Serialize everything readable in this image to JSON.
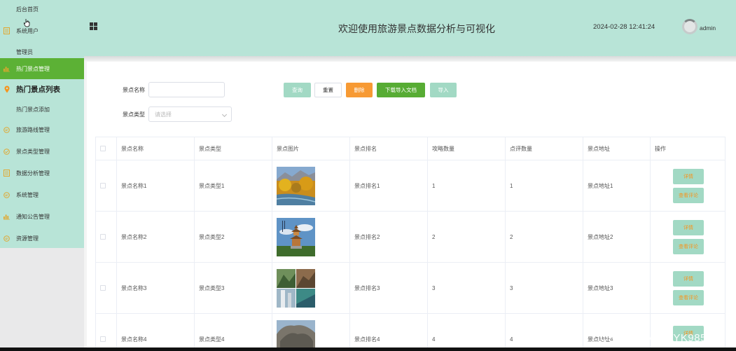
{
  "sidebar": {
    "items": [
      {
        "label": "后台首页",
        "icon": "none",
        "type": "sub"
      },
      {
        "label": "系统用户",
        "icon": "list-icon",
        "type": "group"
      },
      {
        "label": "管理员",
        "icon": "none",
        "type": "sub"
      },
      {
        "label": "热门景点管理",
        "icon": "bar-chart-icon",
        "type": "active"
      },
      {
        "label": "热门景点列表",
        "icon": "location-pin-icon",
        "type": "bold"
      },
      {
        "label": "热门景点添加",
        "icon": "none",
        "type": "sub"
      },
      {
        "label": "旅游路线管理",
        "icon": "chat-bubble-icon",
        "type": "group"
      },
      {
        "label": "景点类型管理",
        "icon": "check-circle-icon",
        "type": "group"
      },
      {
        "label": "数据分析管理",
        "icon": "list-icon",
        "type": "group"
      },
      {
        "label": "系统管理",
        "icon": "chat-bubble-icon",
        "type": "group"
      },
      {
        "label": "通知公告管理",
        "icon": "bar-chart-icon",
        "type": "group"
      },
      {
        "label": "资源管理",
        "icon": "chat-bubble-icon",
        "type": "group"
      }
    ]
  },
  "header": {
    "title": "欢迎使用旅游景点数据分析与可视化",
    "datetime": "2024-02-28 12:41:24",
    "user": "admin"
  },
  "search": {
    "name_label": "景点名称",
    "name_value": "",
    "type_label": "景点类型",
    "type_placeholder": "请选择"
  },
  "buttons": {
    "query": "查询",
    "reset": "重置",
    "delete": "删除",
    "download": "下载导入文档",
    "import": "导入"
  },
  "table": {
    "headers": [
      "景点名称",
      "景点类型",
      "景点图片",
      "景点排名",
      "攻略数量",
      "点评数量",
      "景点地址",
      "操作"
    ],
    "rows": [
      {
        "name": "景点名称1",
        "type": "景点类型1",
        "rank": "景点排名1",
        "guides": "1",
        "reviews": "1",
        "address": "景点地址1"
      },
      {
        "name": "景点名称2",
        "type": "景点类型2",
        "rank": "景点排名2",
        "guides": "2",
        "reviews": "2",
        "address": "景点地址2"
      },
      {
        "name": "景点名称3",
        "type": "景点类型3",
        "rank": "景点排名3",
        "guides": "3",
        "reviews": "3",
        "address": "景点地址3"
      },
      {
        "name": "景点名称4",
        "type": "景点类型4",
        "rank": "景点排名4",
        "guides": "4",
        "reviews": "4",
        "address": "景点地址4"
      }
    ],
    "op_detail": "详情",
    "op_review": "查看评论"
  },
  "watermark": "CSDN @VX_ZYK985",
  "colors": {
    "theme": "#b8e4d7",
    "active": "#5cb135",
    "btn_mint": "#a2d9c4",
    "btn_orange": "#f79a34",
    "btn_green": "#57ac34",
    "op_text": "#f7941d"
  }
}
